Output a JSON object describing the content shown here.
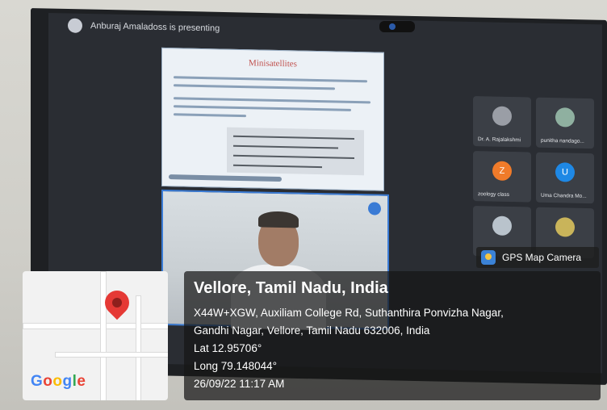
{
  "meeting": {
    "presenter_text": "Anburaj Amaladoss is presenting",
    "slide_title": "Minisatellites",
    "participants": [
      {
        "name": "Dr. A. Rajalakshmi",
        "initial": "",
        "color": "#9a9ea6"
      },
      {
        "name": "punitha nandago...",
        "initial": "",
        "color": "#8fb0a0"
      },
      {
        "name": "zoology class",
        "initial": "Z",
        "color": "#f07b2a"
      },
      {
        "name": "Uma Chandra Mo...",
        "initial": "U",
        "color": "#1e88e5"
      },
      {
        "name": "",
        "initial": "",
        "color": "#b9c3cc"
      },
      {
        "name": "",
        "initial": "",
        "color": "#c9b45a"
      },
      {
        "name": "",
        "initial": "",
        "color": "#cc4b3c"
      }
    ]
  },
  "gps_badge": {
    "label": "GPS Map Camera"
  },
  "map": {
    "logo_text": "Google"
  },
  "location": {
    "city": "Vellore, Tamil Nadu, India",
    "address_line1": "X44W+XGW, Auxiliam College Rd, Suthanthira Ponvizha Nagar,",
    "address_line2": "Gandhi Nagar, Vellore, Tamil Nadu 632006, India",
    "lat": "Lat 12.95706°",
    "long": "Long 79.148044°",
    "datetime": "26/09/22 11:17 AM"
  }
}
